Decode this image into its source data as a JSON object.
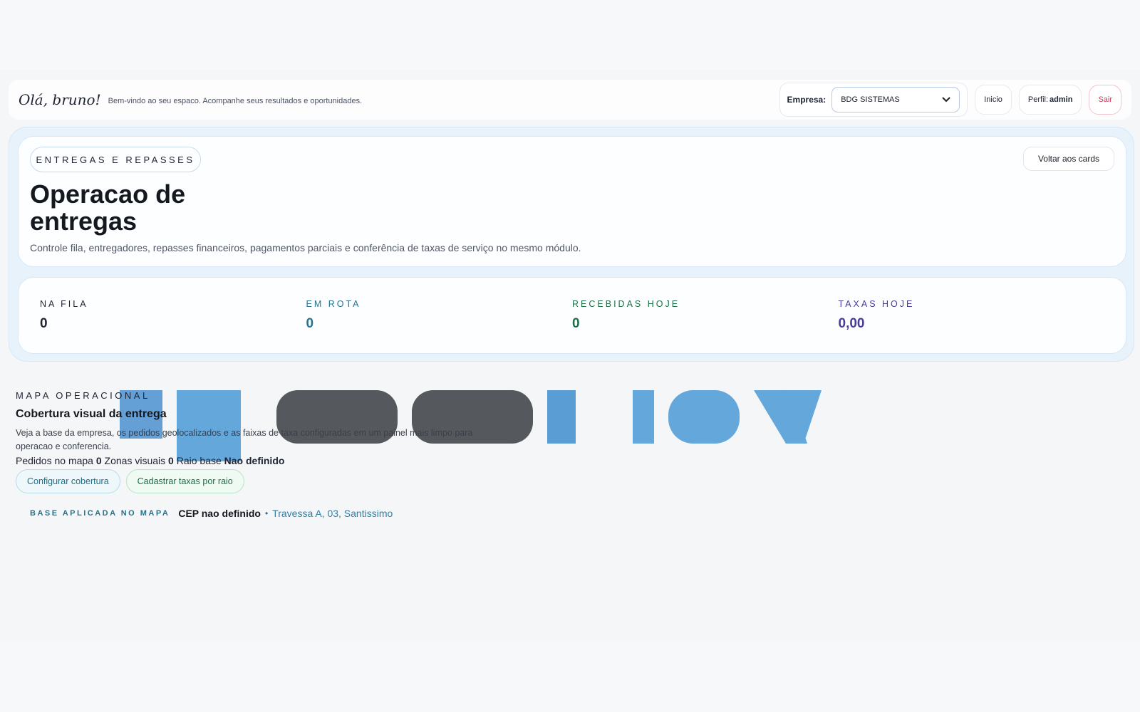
{
  "header": {
    "greeting": "Olá, bruno!",
    "subtitle": "Bem-vindo ao seu espaco. Acompanhe seus resultados e oportunidades.",
    "company_label": "Empresa:",
    "company_value": "BDG SISTEMAS",
    "home_label": "Inicio",
    "profile_prefix": "Perfil:",
    "profile_value": "admin",
    "exit_label": "Sair"
  },
  "hero": {
    "kicker": "ENTREGAS E REPASSES",
    "back_label": "Voltar aos cards",
    "title": "Operacao de entregas",
    "description": "Controle fila, entregadores, repasses financeiros, pagamentos parciais e conferência de taxas de serviço no mesmo módulo."
  },
  "stats": [
    {
      "label": "NA FILA",
      "value": "0",
      "color": "#1f2433"
    },
    {
      "label": "EM ROTA",
      "value": "0",
      "color": "#27728c"
    },
    {
      "label": "RECEBIDAS HOJE",
      "value": "0",
      "color": "#1d6e45"
    },
    {
      "label": "TAXAS HOJE",
      "value": "0,00",
      "color": "#4a3a9a"
    }
  ],
  "map": {
    "kicker": "MAPA OPERACIONAL",
    "title": "Cobertura visual da entrega",
    "description": "Veja a base da empresa, os pedidos geolocalizados e as faixas de taxa configuradas em um painel mais limpo para operacao e conferencia.",
    "orders_label": "Pedidos no mapa",
    "orders_value": "0",
    "zones_label": "Zonas visuais",
    "zones_value": "0",
    "radius_label": "Raio base",
    "radius_value": "Nao definido",
    "configure_label": "Configurar cobertura",
    "register_label": "Cadastrar taxas por raio",
    "base_kicker": "BASE APLICADA NO MAPA",
    "base_cep": "CEP nao definido",
    "base_sep": "•",
    "base_address": "Travessa A, 03, Santissimo"
  },
  "colors": {
    "accent_blue": "#27728c",
    "accent_green": "#1d6e45",
    "accent_purple": "#4a3a9a",
    "exit_red": "#d0365a"
  }
}
